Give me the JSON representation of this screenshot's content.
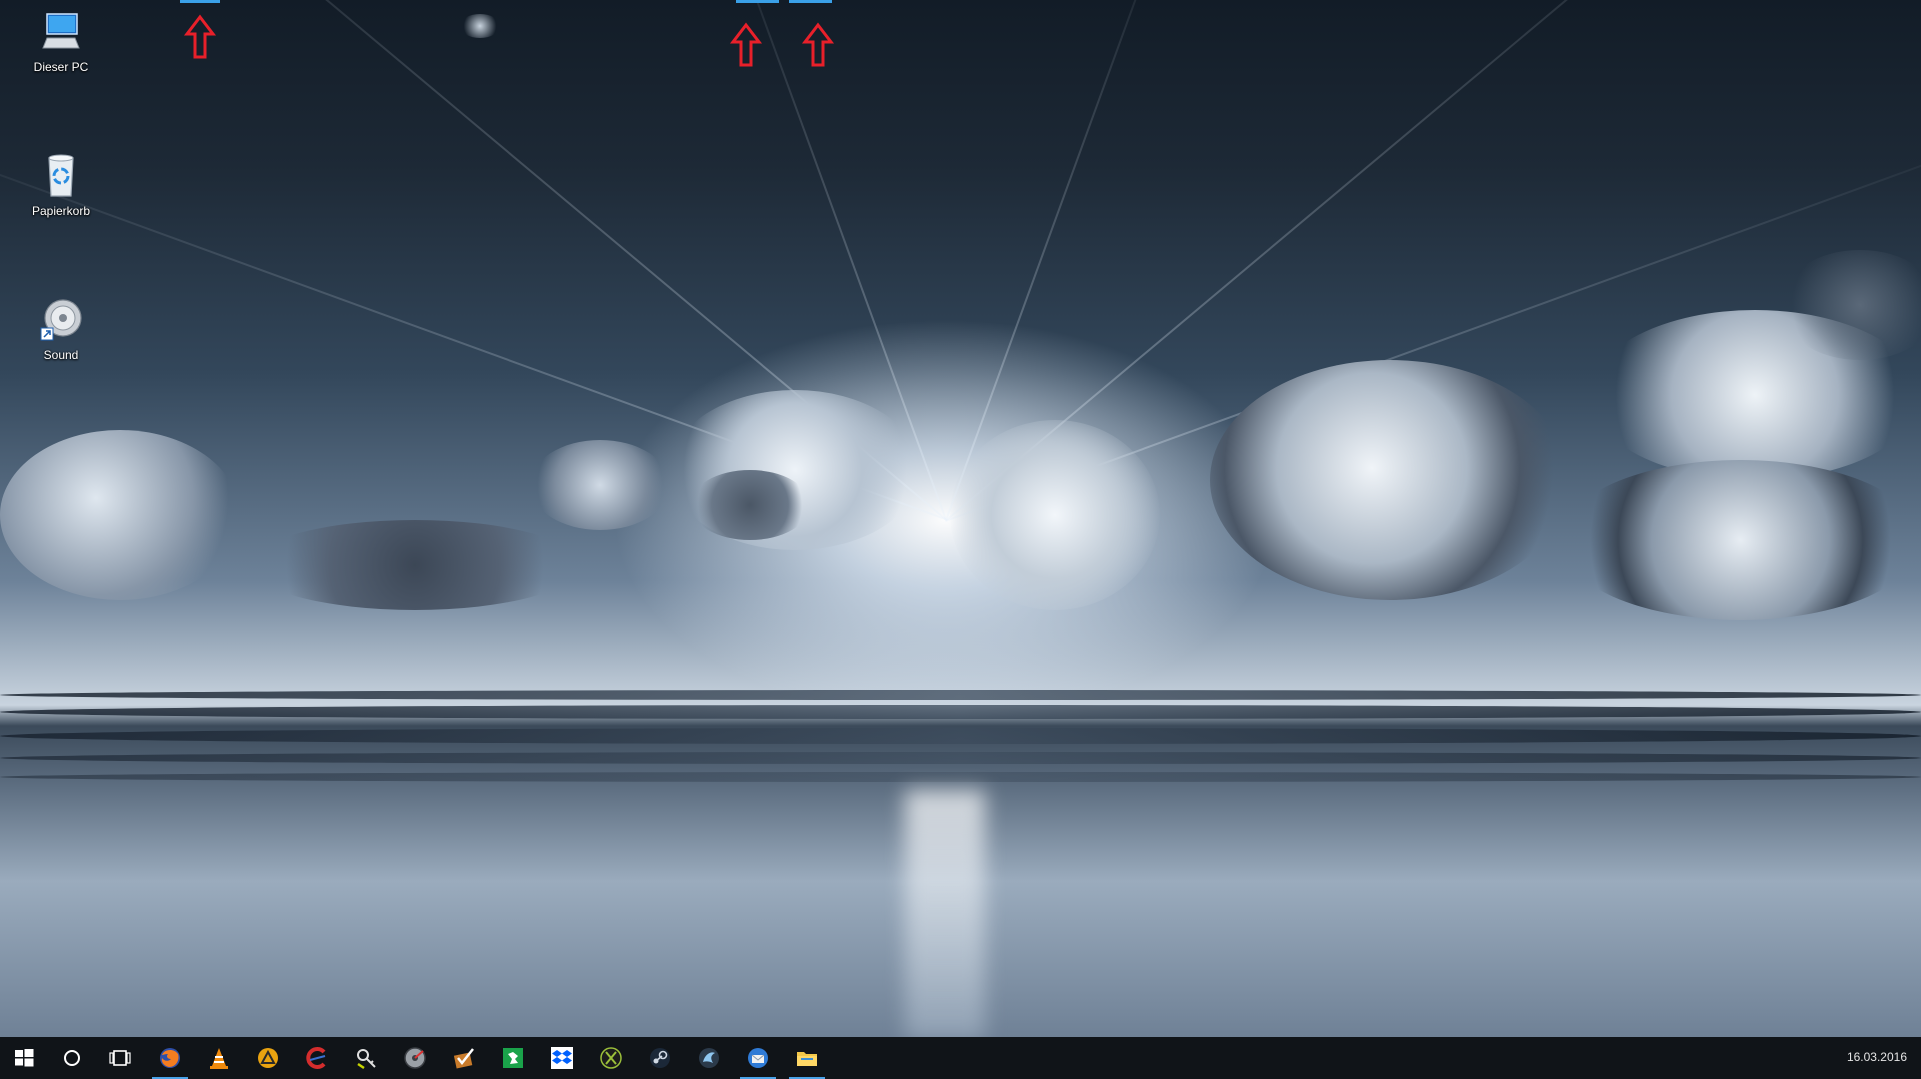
{
  "desktop": {
    "icons": [
      {
        "label": "Dieser PC",
        "icon": "computer-icon"
      },
      {
        "label": "Papierkorb",
        "icon": "recycle-bin-icon"
      },
      {
        "label": "Sound",
        "icon": "speaker-icon"
      }
    ]
  },
  "taskbar": {
    "start": {
      "icon": "windows-logo-icon"
    },
    "search": {
      "icon": "cortana-circle-icon"
    },
    "task_view": {
      "icon": "task-view-icon"
    },
    "pinned": [
      {
        "icon": "firefox-icon",
        "active": true
      },
      {
        "icon": "vlc-icon",
        "active": false
      },
      {
        "icon": "antivirus-icon",
        "active": false
      },
      {
        "icon": "ccleaner-icon",
        "active": false
      },
      {
        "icon": "kleopatra-icon",
        "active": false
      },
      {
        "icon": "disk-tool-icon",
        "active": false
      },
      {
        "icon": "checklist-icon",
        "active": false
      },
      {
        "icon": "green-app-icon",
        "active": false
      },
      {
        "icon": "dropbox-icon",
        "active": false
      },
      {
        "icon": "xbox-icon",
        "active": false
      },
      {
        "icon": "steam-icon",
        "active": false
      },
      {
        "icon": "phoenix-icon",
        "active": false
      },
      {
        "icon": "thunderbird-icon",
        "active": true
      },
      {
        "icon": "file-explorer-icon",
        "active": true
      }
    ],
    "clock": {
      "date": "16.03.2016"
    }
  },
  "colors": {
    "taskbar_bg": "#101418",
    "active_indicator": "#4aa3e8",
    "annotation_arrow": "#e8202a"
  }
}
